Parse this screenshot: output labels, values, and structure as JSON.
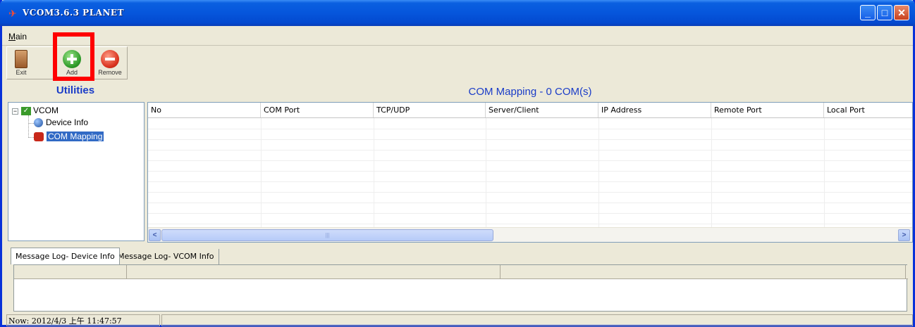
{
  "window": {
    "title": "VCOM3.6.3 PLANET"
  },
  "title_buttons": {
    "minimize": "_",
    "maximize": "□",
    "close": "✕"
  },
  "menu": {
    "main_label": "Main",
    "main_mnemonic": "M",
    "main_rest": "ain"
  },
  "toolbar": {
    "exit_label": "Exit",
    "add_label": "Add",
    "remove_label": "Remove"
  },
  "left_pane": {
    "header": "Utilities",
    "tree": {
      "root": {
        "label": "VCOM",
        "expander": "−"
      },
      "children": [
        {
          "label": "Device Info",
          "icon": "globe-icon"
        },
        {
          "label": "COM Mapping",
          "icon": "com-mapping-icon",
          "selected": true
        }
      ]
    }
  },
  "right_pane": {
    "header": "COM Mapping - 0 COM(s)",
    "columns": [
      "No",
      "COM Port",
      "TCP/UDP",
      "Server/Client",
      "IP Address",
      "Remote Port",
      "Local Port"
    ],
    "rows": []
  },
  "scrollbar": {
    "left_arrow": "<",
    "right_arrow": ">",
    "grip": "|||"
  },
  "log_tabs": [
    {
      "label": "Message Log- Device Info",
      "active": true
    },
    {
      "label": "Message Log- VCOM Info",
      "active": false
    }
  ],
  "status": {
    "now": "Now: 2012/4/3 上午 11:47:57"
  },
  "colors": {
    "accent_blue": "#1a3cc8",
    "titlebar": "#0656dc",
    "highlight_box": "#ff0000",
    "selection": "#316ac5"
  }
}
